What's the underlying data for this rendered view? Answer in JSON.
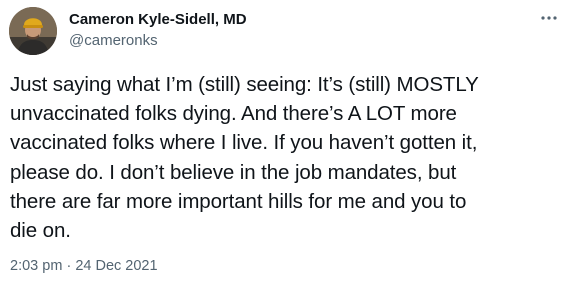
{
  "author": {
    "display_name": "Cameron Kyle-Sidell, MD",
    "handle": "@cameronks",
    "avatar_icon": "profile-photo"
  },
  "tweet": {
    "text": "Just saying what I’m (still) seeing:  It’s (still) MOSTLY\nunvaccinated folks dying.  And there’s A LOT more\nvaccinated folks where I live. If you haven’t gotten it,\nplease do.  I don’t believe in the job mandates, but\nthere are far more important hills for me and you to\ndie on.",
    "time": "2:03 pm",
    "separator": "·",
    "date": "24 Dec 2021"
  },
  "actions": {
    "more_icon": "more-horizontal-icon"
  },
  "colors": {
    "text": "#0f1419",
    "secondary": "#536471",
    "background": "#ffffff"
  }
}
